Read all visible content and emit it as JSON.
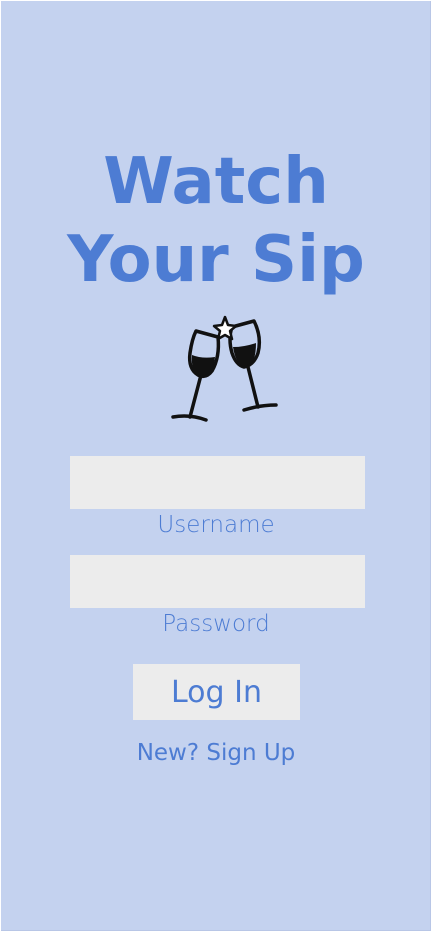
{
  "app": {
    "title_line1": "Watch",
    "title_line2": "Your Sip",
    "logo_icon": "champagne-toast-icon"
  },
  "form": {
    "username_value": "",
    "username_label": "Username",
    "password_value": "",
    "password_label": "Password",
    "login_label": "Log In",
    "signup_label": "New? Sign Up"
  },
  "colors": {
    "background": "#c4d2ef",
    "accent": "#4d7cd3",
    "field_bg": "#ececec"
  }
}
